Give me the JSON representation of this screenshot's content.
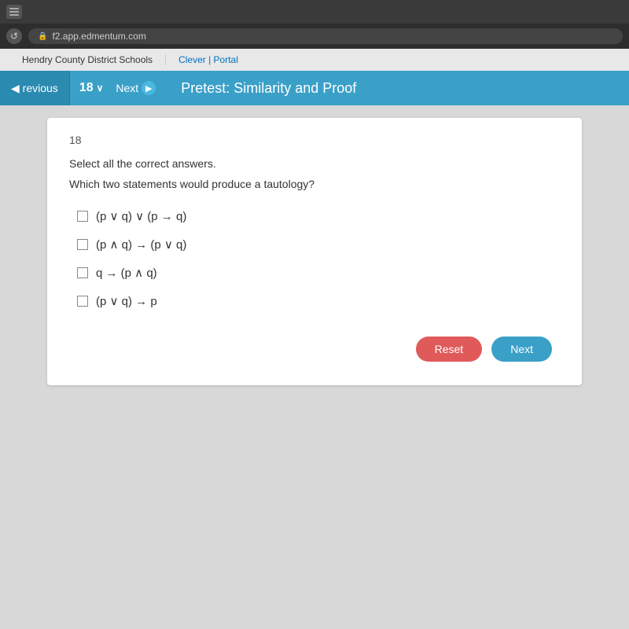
{
  "browser": {
    "url": "f2.app.edmentum.com",
    "lock_icon": "🔒",
    "refresh_icon": "↺"
  },
  "bookmarks": {
    "items": [
      {
        "label": "Hendry County District Schools"
      },
      {
        "label": "Clever | Portal"
      }
    ]
  },
  "nav": {
    "previous_label": "◀ revious",
    "question_number": "18",
    "chevron": "∨",
    "next_label": "Next",
    "next_icon": "▶",
    "title": "Pretest: Similarity and Proof"
  },
  "question": {
    "number": "18",
    "instruction": "Select all the correct answers.",
    "question_text": "Which two statements would produce a tautology?",
    "options": [
      {
        "id": "a",
        "text": "(p ∨ q) ∨ (p → q)"
      },
      {
        "id": "b",
        "text": "(p ∧ q) → (p ∨ q)"
      },
      {
        "id": "c",
        "text": "q → (p ∧ q)"
      },
      {
        "id": "d",
        "text": "(p ∨ q) → p"
      }
    ],
    "reset_label": "Reset",
    "next_label": "Next"
  }
}
